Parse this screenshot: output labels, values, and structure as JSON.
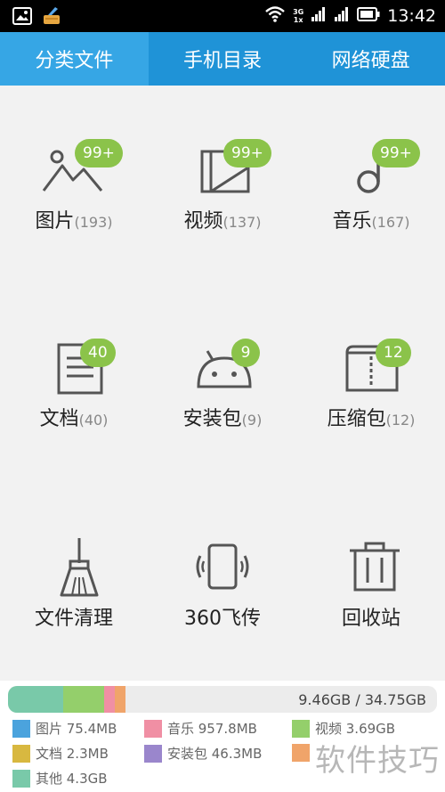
{
  "status_bar": {
    "time": "13:42",
    "net_top": "3G",
    "net_bottom": "1x",
    "icons": [
      "image-icon",
      "broom-icon",
      "wifi-icon",
      "signal-icon",
      "signal-icon",
      "battery-icon"
    ]
  },
  "tabs": [
    {
      "label": "分类文件",
      "active": true
    },
    {
      "label": "手机目录",
      "active": false
    },
    {
      "label": "网络硬盘",
      "active": false
    }
  ],
  "categories": [
    {
      "name": "图片",
      "count": "(193)",
      "badge": "99+",
      "icon": "picture-icon"
    },
    {
      "name": "视频",
      "count": "(137)",
      "badge": "99+",
      "icon": "video-icon"
    },
    {
      "name": "音乐",
      "count": "(167)",
      "badge": "99+",
      "icon": "music-icon"
    },
    {
      "name": "文档",
      "count": "(40)",
      "badge": "40",
      "icon": "document-icon"
    },
    {
      "name": "安装包",
      "count": "(9)",
      "badge": "9",
      "icon": "android-icon"
    },
    {
      "name": "压缩包",
      "count": "(12)",
      "badge": "12",
      "icon": "archive-icon"
    },
    {
      "name": "文件清理",
      "count": "",
      "badge": "",
      "icon": "broom-icon"
    },
    {
      "name": "360飞传",
      "count": "",
      "badge": "",
      "icon": "phone-transfer-icon"
    },
    {
      "name": "回收站",
      "count": "",
      "badge": "",
      "icon": "trash-icon"
    }
  ],
  "storage": {
    "used_total": "9.46GB / 34.75GB",
    "segments": [
      {
        "color": "#79c9a9",
        "fraction": 0.128
      },
      {
        "color": "#94cf6b",
        "fraction": 0.096
      },
      {
        "color": "#f08fa4",
        "fraction": 0.025
      },
      {
        "color": "#f0a46a",
        "fraction": 0.025
      }
    ],
    "legend": [
      {
        "label": "图片 75.4MB",
        "color": "#4ba3dd"
      },
      {
        "label": "音乐 957.8MB",
        "color": "#f08fa4"
      },
      {
        "label": "视频 3.69GB",
        "color": "#94cf6b"
      },
      {
        "label": "文档 2.3MB",
        "color": "#d8b840"
      },
      {
        "label": "安装包 46.3MB",
        "color": "#9a86cc"
      },
      {
        "label": "",
        "color": "#f0a46a"
      },
      {
        "label": "其他 4.3GB",
        "color": "#79c9a9"
      }
    ]
  },
  "watermark": "软件技巧"
}
